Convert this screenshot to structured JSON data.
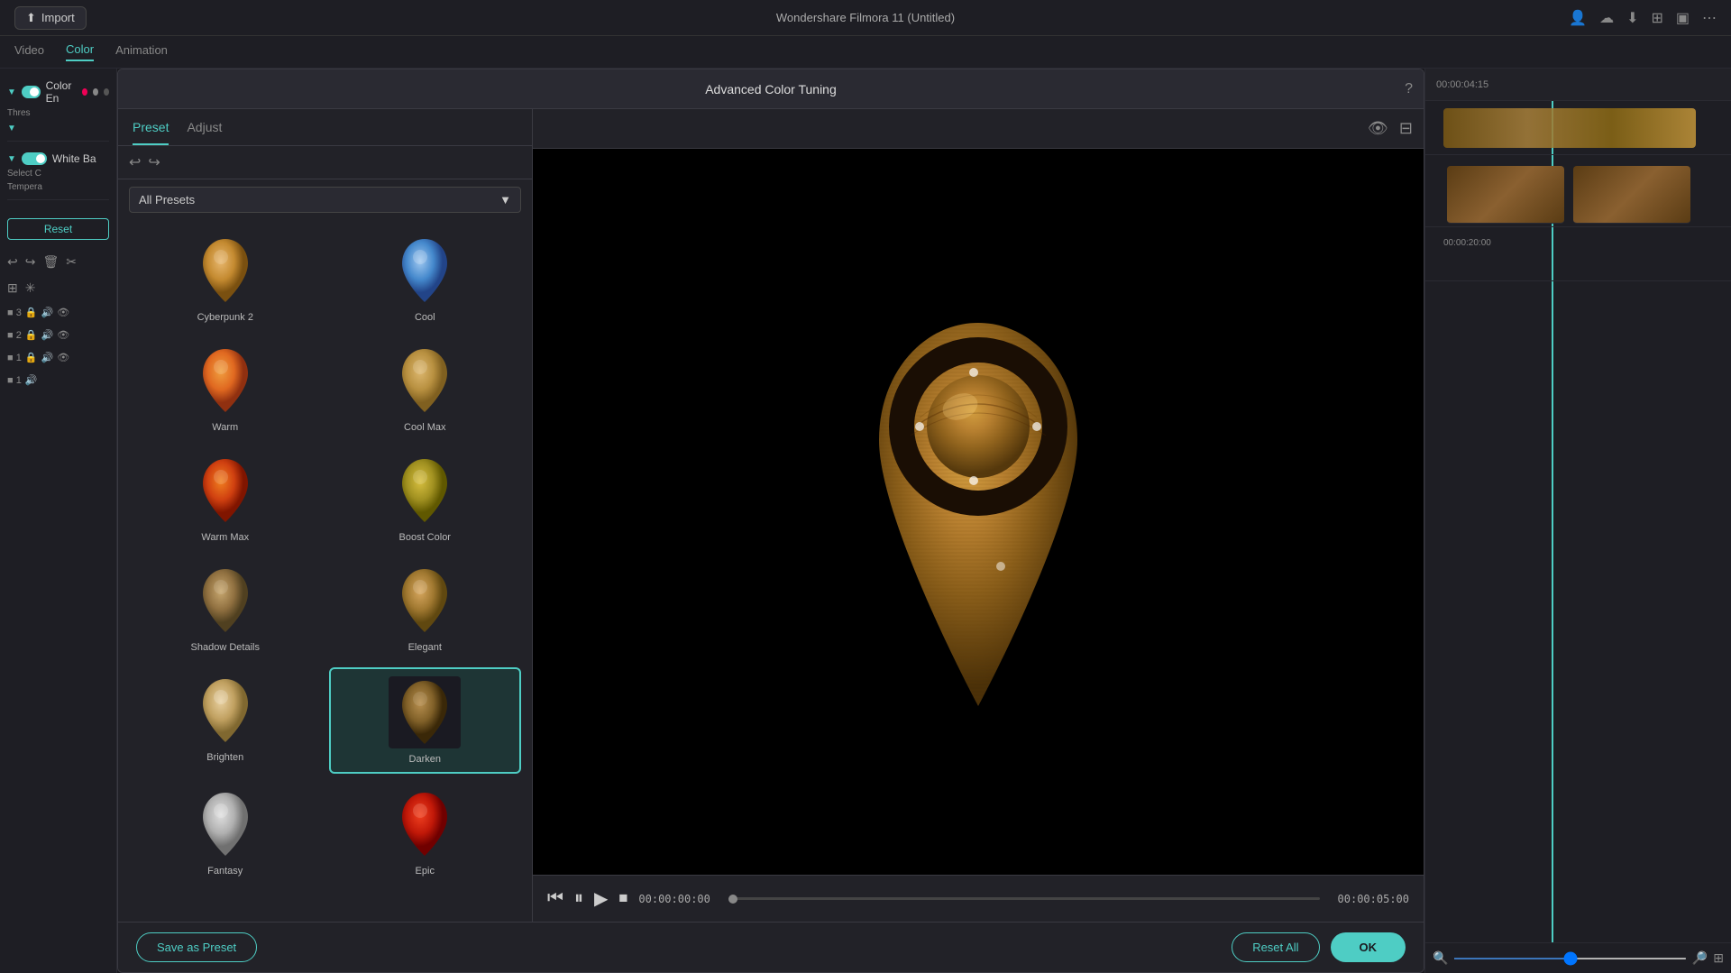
{
  "app": {
    "title": "Wondershare Filmora 11 (Untitled)"
  },
  "topbar": {
    "import_label": "Import"
  },
  "nav": {
    "tabs": [
      {
        "label": "Video",
        "active": false
      },
      {
        "label": "Color",
        "active": true
      },
      {
        "label": "Animation",
        "active": false
      }
    ]
  },
  "left_panel": {
    "color_enable_label": "Color En",
    "white_balance_label": "White Ba",
    "select_label": "Select C",
    "temperature_label": "Tempera",
    "threshold_label": "Thres",
    "reset_label": "Reset"
  },
  "dialog": {
    "title": "Advanced Color Tuning",
    "tabs": [
      {
        "label": "Preset",
        "active": true
      },
      {
        "label": "Adjust",
        "active": false
      }
    ],
    "dropdown": {
      "value": "All Presets"
    },
    "presets": [
      {
        "name": "Cyberpunk 2",
        "selected": false,
        "color": "#c8853a",
        "type": "warm-gold"
      },
      {
        "name": "Cool",
        "selected": false,
        "color": "#5599cc",
        "type": "cool-blue"
      },
      {
        "name": "Warm",
        "selected": false,
        "color": "#e07830",
        "type": "warm-orange"
      },
      {
        "name": "Cool Max",
        "selected": false,
        "color": "#c49a40",
        "type": "warm-gold2"
      },
      {
        "name": "Warm Max",
        "selected": false,
        "color": "#e06020",
        "type": "hot-orange"
      },
      {
        "name": "Boost Color",
        "selected": false,
        "color": "#d4a020",
        "type": "gold"
      },
      {
        "name": "Shadow Details",
        "selected": false,
        "color": "#b08830",
        "type": "shadow-gold"
      },
      {
        "name": "Elegant",
        "selected": false,
        "color": "#c4923c",
        "type": "elegant-gold"
      },
      {
        "name": "Brighten",
        "selected": false,
        "color": "#d4a840",
        "type": "brighten-gold"
      },
      {
        "name": "Darken",
        "selected": true,
        "color": "#a07830",
        "type": "dark-gold"
      },
      {
        "name": "Fantasy",
        "selected": false,
        "color": "#d0d0d0",
        "type": "fantasy"
      },
      {
        "name": "Epic",
        "selected": false,
        "color": "#e04010",
        "type": "epic-red"
      }
    ],
    "playback": {
      "time_current": "00:00:00:00",
      "time_total": "00:00:05:00"
    },
    "footer": {
      "save_preset_label": "Save as Preset",
      "reset_all_label": "Reset All",
      "ok_label": "OK"
    }
  },
  "timeline": {
    "time1": "00:00:04:15",
    "time2": "00:00:20:00",
    "track_labels": [
      "3",
      "2",
      "1",
      "1"
    ]
  }
}
